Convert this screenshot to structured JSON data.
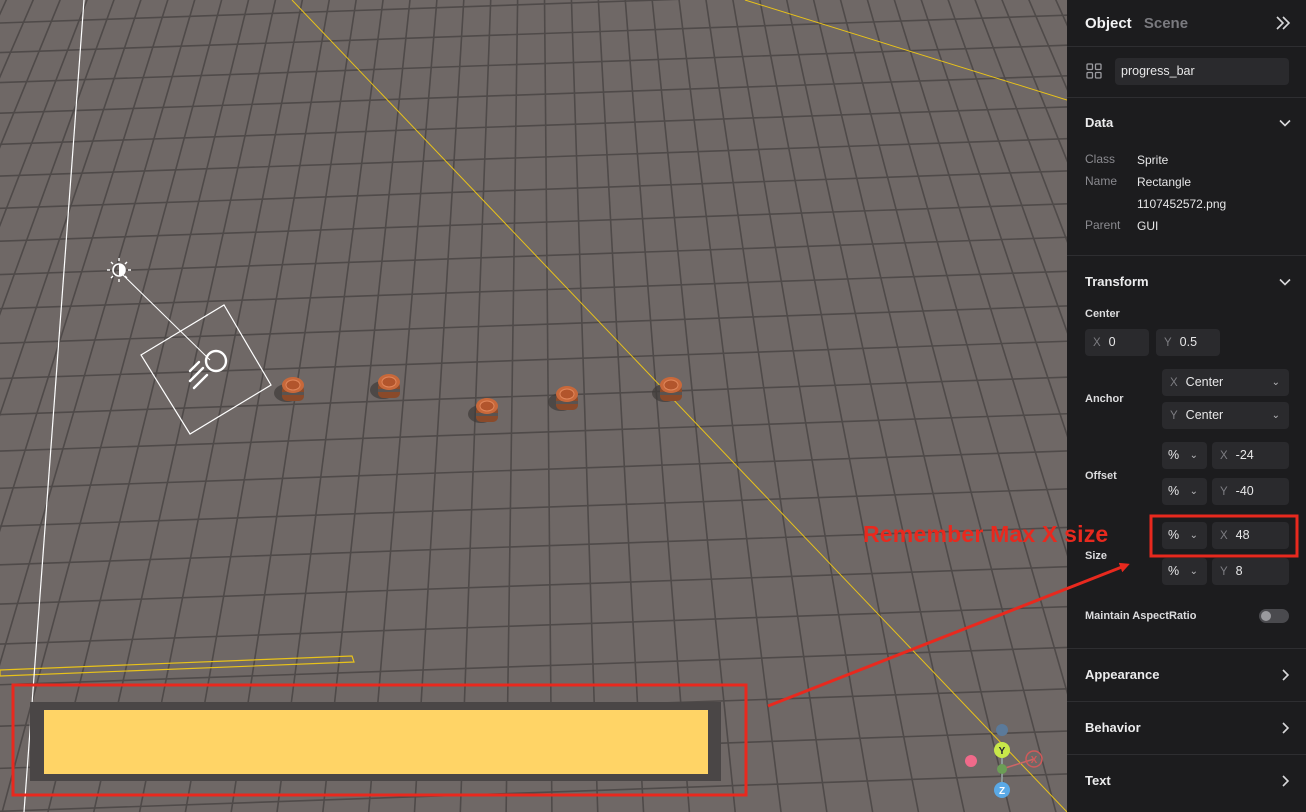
{
  "panel": {
    "tabs": [
      {
        "label": "Object",
        "active": true
      },
      {
        "label": "Scene",
        "active": false
      }
    ],
    "object_name": "progress_bar",
    "data": {
      "title": "Data",
      "rows": [
        {
          "key": "Class",
          "value": "Sprite"
        },
        {
          "key": "Name",
          "value": "Rectangle"
        },
        {
          "key": "",
          "value": "1107452572.png"
        },
        {
          "key": "Parent",
          "value": "GUI"
        }
      ]
    },
    "transform": {
      "title": "Transform",
      "center_label": "Center",
      "center": {
        "x_axis": "X",
        "x": "0",
        "y_axis": "Y",
        "y": "0.5"
      },
      "anchor_label": "Anchor",
      "anchor": {
        "x_axis": "X",
        "x": "Center",
        "y_axis": "Y",
        "y": "Center"
      },
      "offset_label": "Offset",
      "offset": {
        "x_unit": "%",
        "x_axis": "X",
        "x": "-24",
        "y_unit": "%",
        "y_axis": "Y",
        "y": "-40"
      },
      "size_label": "Size",
      "size": {
        "x_unit": "%",
        "x_axis": "X",
        "x": "48",
        "y_unit": "%",
        "y_axis": "Y",
        "y": "8"
      },
      "aspect_label": "Maintain AspectRatio",
      "aspect_on": false
    },
    "sections": [
      {
        "label": "Appearance"
      },
      {
        "label": "Behavior"
      },
      {
        "label": "Text"
      }
    ]
  },
  "annotation": {
    "text": "Remember Max X size",
    "color": "#e8291e"
  },
  "progress_bar": {
    "fill_color": "#ffd466",
    "track_color": "#4a4646",
    "fill_fraction": 0.92
  },
  "gizmo": {
    "y": "Y",
    "x": "X",
    "z": "Z"
  },
  "colors": {
    "panel_bg": "#1c1c1e",
    "ground": "#6f6866",
    "guide": "#e8c21a",
    "annotation": "#e8291e"
  }
}
